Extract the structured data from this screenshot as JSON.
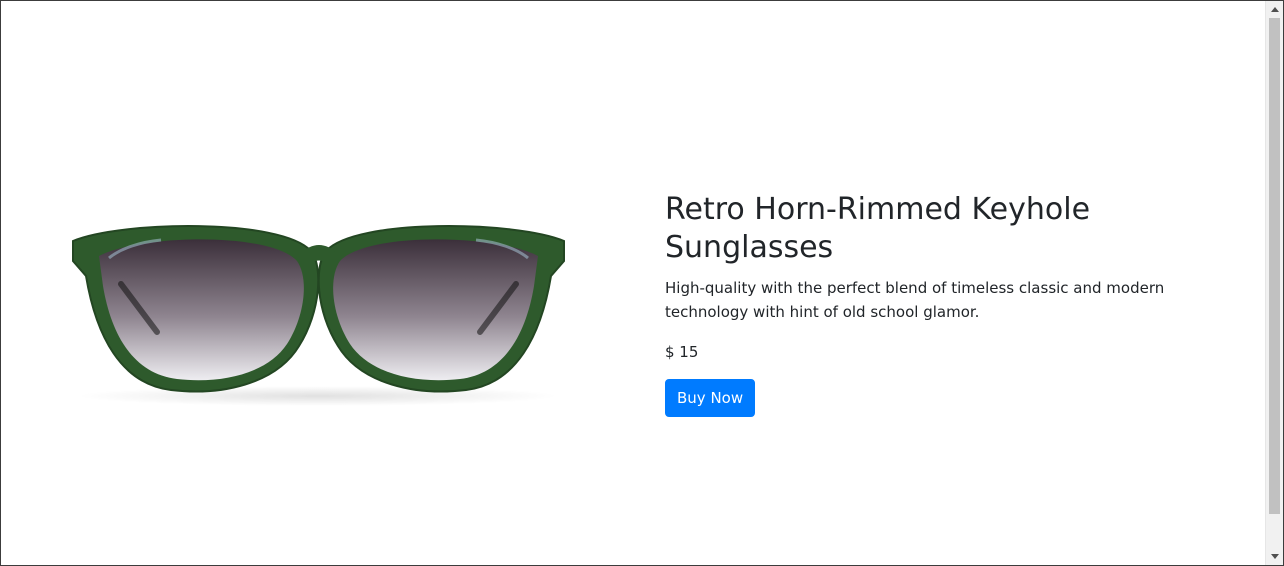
{
  "product": {
    "image_alt": "green sunglasses",
    "title": "Retro Horn-Rimmed Keyhole Sunglasses",
    "description": "High-quality with the perfect blend of timeless classic and modern technology with hint of old school glamor.",
    "price": "$ 15",
    "buy_label": "Buy Now"
  },
  "colors": {
    "accent": "#007bff",
    "frame_green": "#2e5a2c",
    "lens_dark": "#3b2f3a",
    "lens_light": "#d9d6df"
  },
  "icons": {
    "scroll_up": "triangle-up-icon",
    "scroll_down": "triangle-down-icon"
  }
}
